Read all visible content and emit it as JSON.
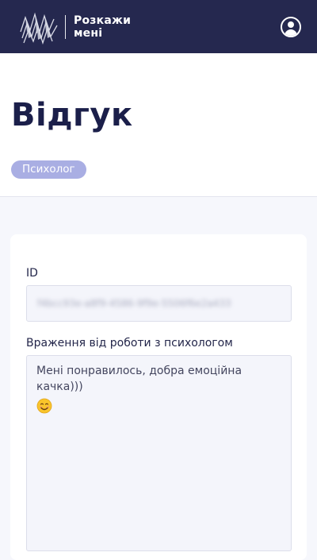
{
  "app": {
    "name_line1": "Розкажи",
    "name_line2": "мені"
  },
  "page": {
    "title": "Відгук",
    "badge": "Психолог"
  },
  "form": {
    "id_label": "ID",
    "id_value": "f4bcc93e-a8f9-4586-9f9e-5506f6e2a433",
    "comment_label": "Враження від роботи з психологом",
    "comment_text": "Мені понравилось, добра емоційна качка)))",
    "comment_emoji_icon": "smiling-face-emoji"
  },
  "colors": {
    "topbar": "#25284f",
    "title": "#1b1f4a",
    "badge": "#a9aee3",
    "background": "#f6f7fc"
  }
}
